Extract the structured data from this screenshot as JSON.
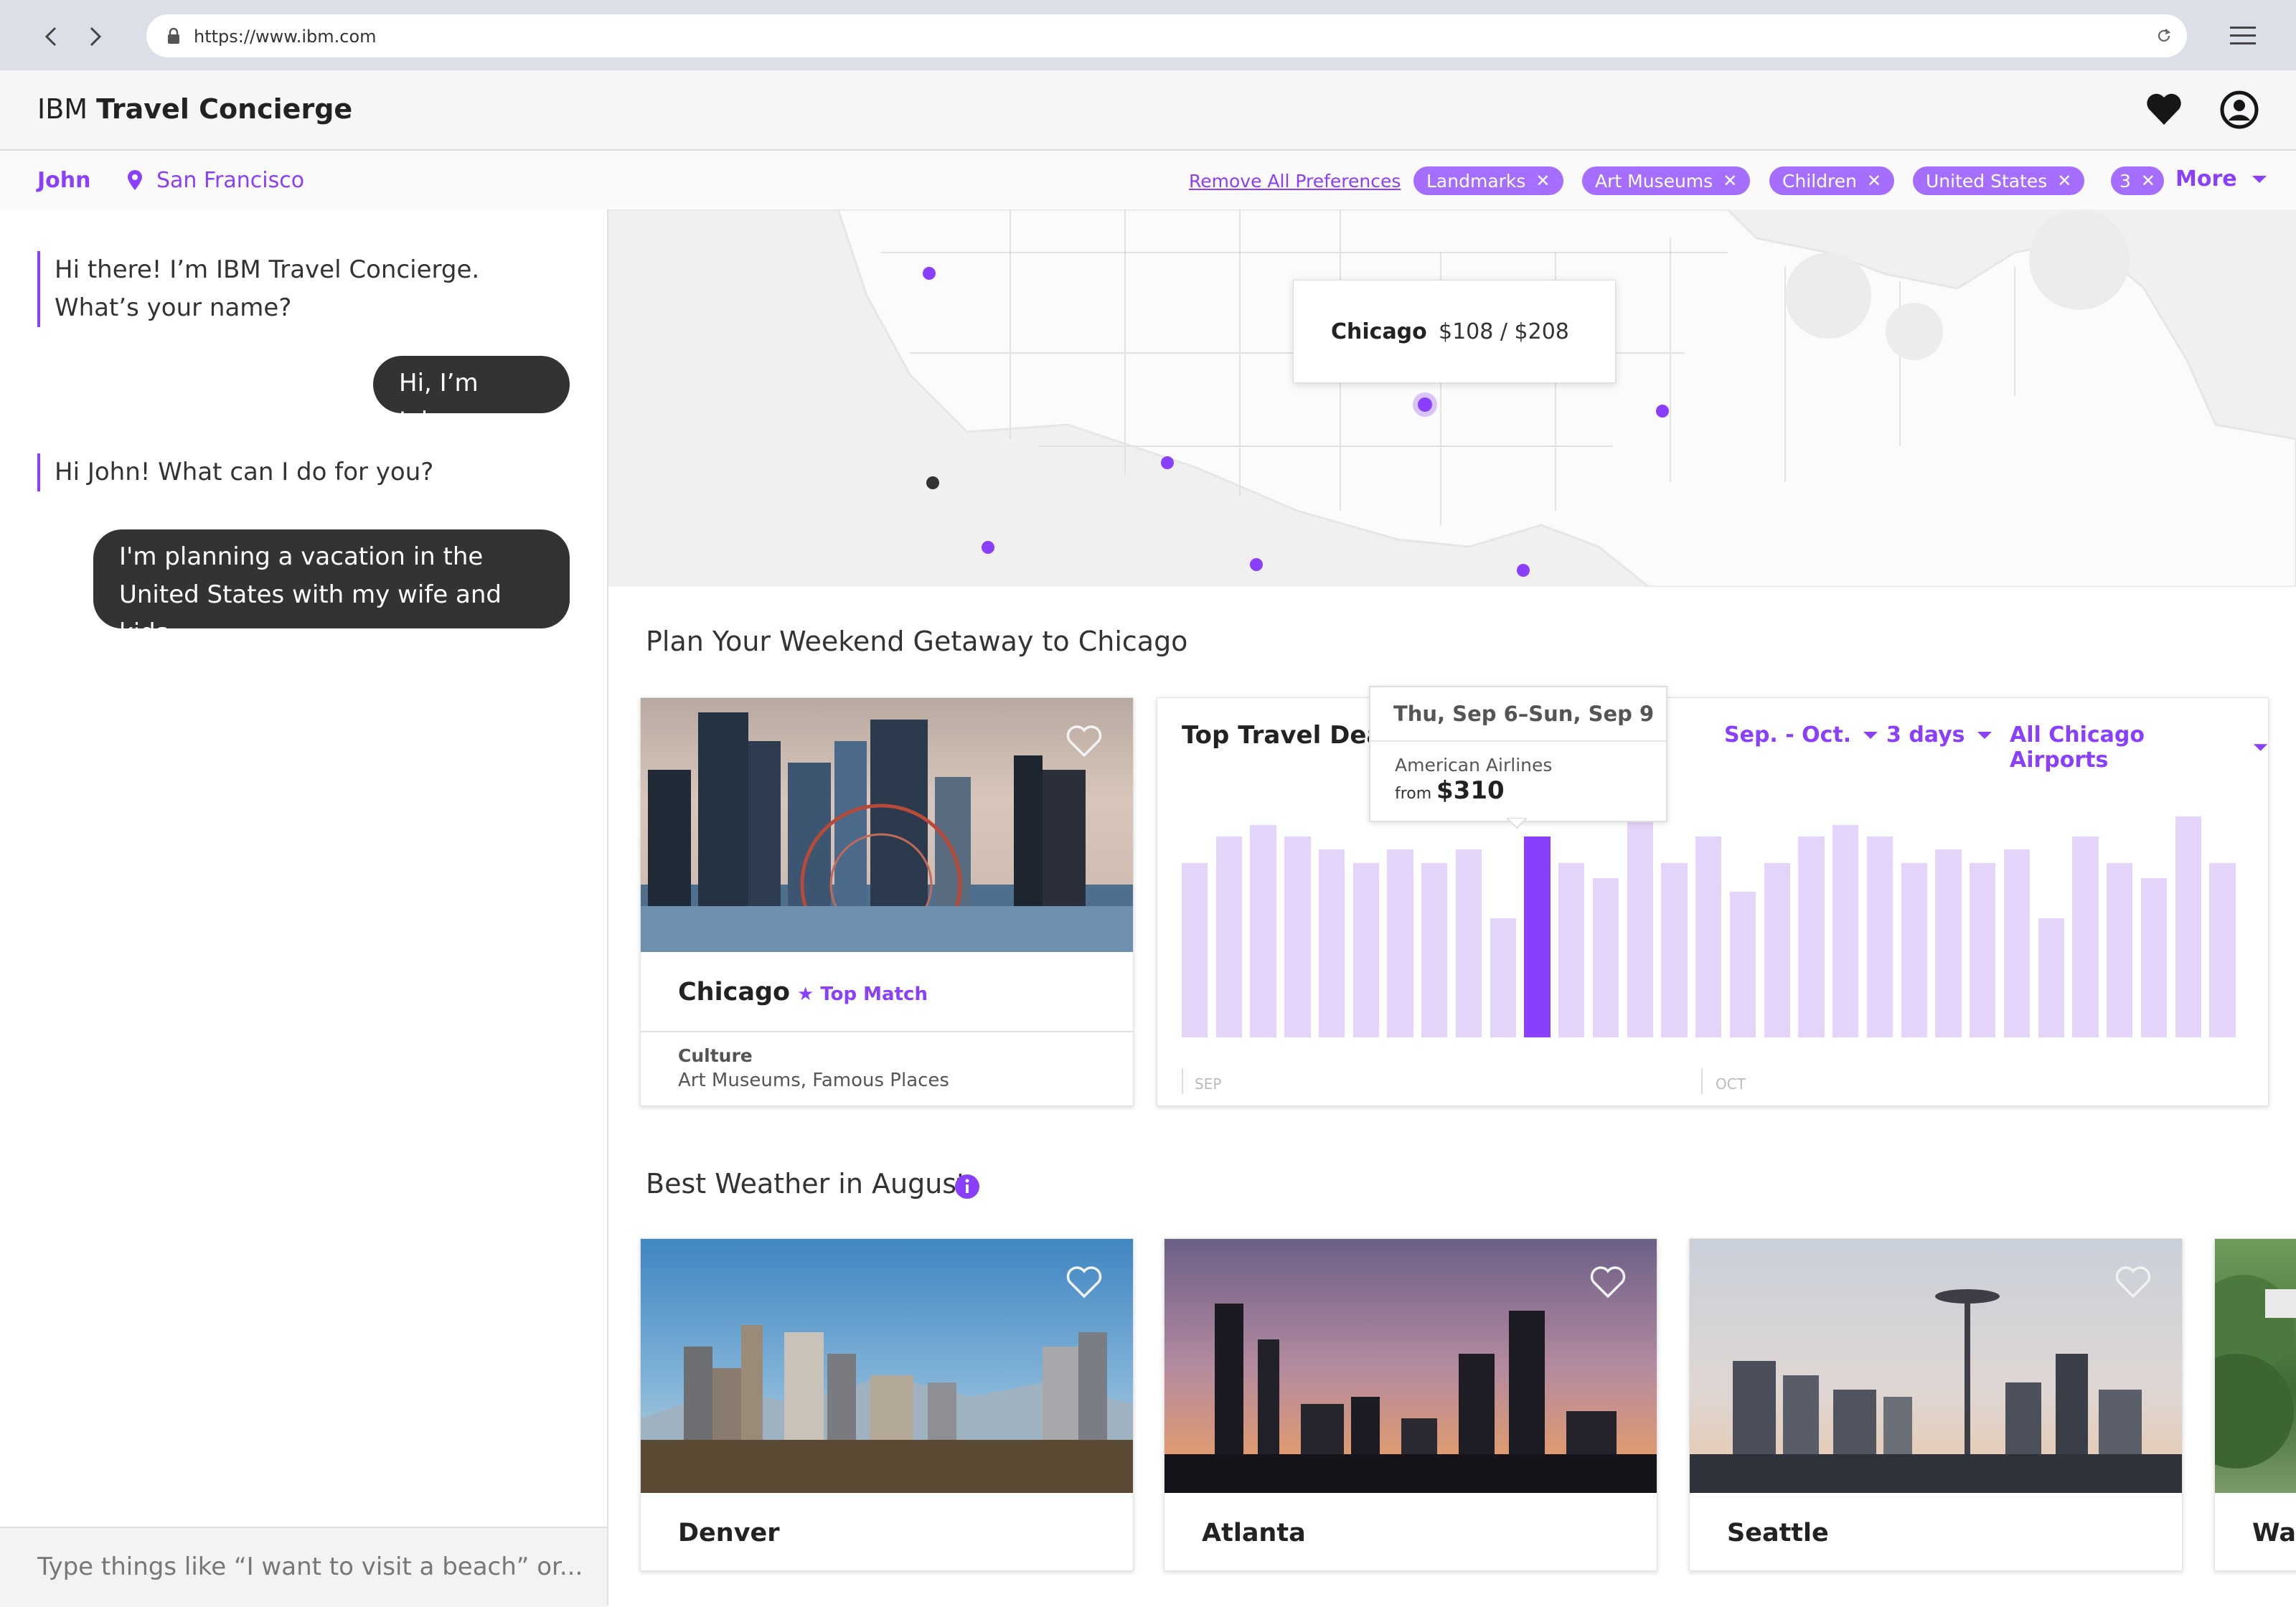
{
  "browser": {
    "url": "https://www.ibm.com"
  },
  "app": {
    "brand_prefix": "IBM",
    "brand_name": "Travel Concierge"
  },
  "prefs": {
    "user": "John",
    "location": "San Francisco",
    "remove_all": "Remove All Preferences",
    "chips": [
      "Landmarks",
      "Art Museums",
      "Children",
      "United States"
    ],
    "more_count": "3",
    "more_label": "More"
  },
  "chat": {
    "messages": [
      {
        "from": "bot",
        "text": "Hi there! I’m IBM Travel Concierge. What’s your name?"
      },
      {
        "from": "user",
        "text": "Hi, I’m John."
      },
      {
        "from": "bot",
        "text": "Hi John! What can I do for you?"
      },
      {
        "from": "user",
        "text": "I'm planning a vacation in the United States with my wife and kids."
      }
    ],
    "input_placeholder": "Type things like “I want to visit a beach” or..."
  },
  "map": {
    "tooltip_city": "Chicago",
    "tooltip_price": "$108 / $208"
  },
  "getaway": {
    "title": "Plan Your Weekend Getaway to Chicago",
    "city": "Chicago",
    "badge": "Top Match",
    "category": "Culture",
    "tags": "Art Museums, Famous Places"
  },
  "deals": {
    "title": "Top Travel Deals",
    "filter_months": "Sep. - Oct.",
    "filter_days": "3 days",
    "filter_airports": "All Chicago Airports",
    "tooltip_dates": "Thu, Sep 6–Sun, Sep 9",
    "tooltip_airline": "American Airlines",
    "tooltip_from": "from",
    "tooltip_price": "$310",
    "axis_sep": "SEP",
    "axis_oct": "OCT",
    "bar_levels": [
      0.79,
      0.91,
      0.96,
      0.91,
      0.85,
      0.79,
      0.85,
      0.79,
      0.85,
      0.54,
      0.91,
      0.79,
      0.72,
      1.0,
      0.79,
      0.91,
      0.66,
      0.79,
      0.91,
      0.96,
      0.91,
      0.79,
      0.85,
      0.79,
      0.85,
      0.54,
      0.91,
      0.79,
      0.72,
      1.0,
      0.79
    ],
    "selected_index": 10
  },
  "weather": {
    "title": "Best Weather in August",
    "cities": [
      "Denver",
      "Atlanta",
      "Seattle",
      "Was"
    ]
  },
  "colors": {
    "accent": "#8a3ffc",
    "chip": "#a56eff",
    "bar": "#e5d4fa"
  }
}
